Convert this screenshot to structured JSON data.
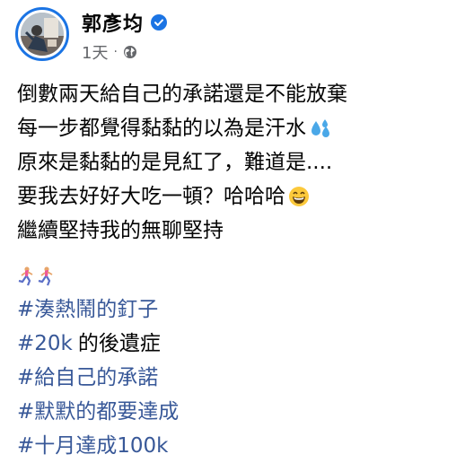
{
  "author": {
    "name": "郭彥均",
    "verified": true
  },
  "meta": {
    "time": "1天",
    "separator": "·",
    "audience_icon": "globe-icon"
  },
  "post": {
    "lines": [
      "倒數兩天給自己的承諾還是不能放棄",
      "每一步都覺得黏黏的以為是汗水",
      "原來是黏黏的是見紅了，難道是....",
      "要我去好好大吃一頓？哈哈哈",
      "繼續堅持我的無聊堅持"
    ],
    "emoji": {
      "line2": "sweat-droplets-emoji",
      "line4": "grinning-face-emoji",
      "runners": "woman-running-emoji"
    },
    "hashtags": [
      {
        "tag": "#湊熱鬧的釘子",
        "suffix": ""
      },
      {
        "tag": "#20k",
        "suffix": "的後遺症"
      },
      {
        "tag": "#給自己的承諾",
        "suffix": ""
      },
      {
        "tag": "#默默的都要達成",
        "suffix": ""
      },
      {
        "tag": "#十月達成100k",
        "suffix": ""
      }
    ]
  },
  "colors": {
    "accent": "#1b74e4",
    "link": "#385898",
    "muted": "#65676b"
  }
}
